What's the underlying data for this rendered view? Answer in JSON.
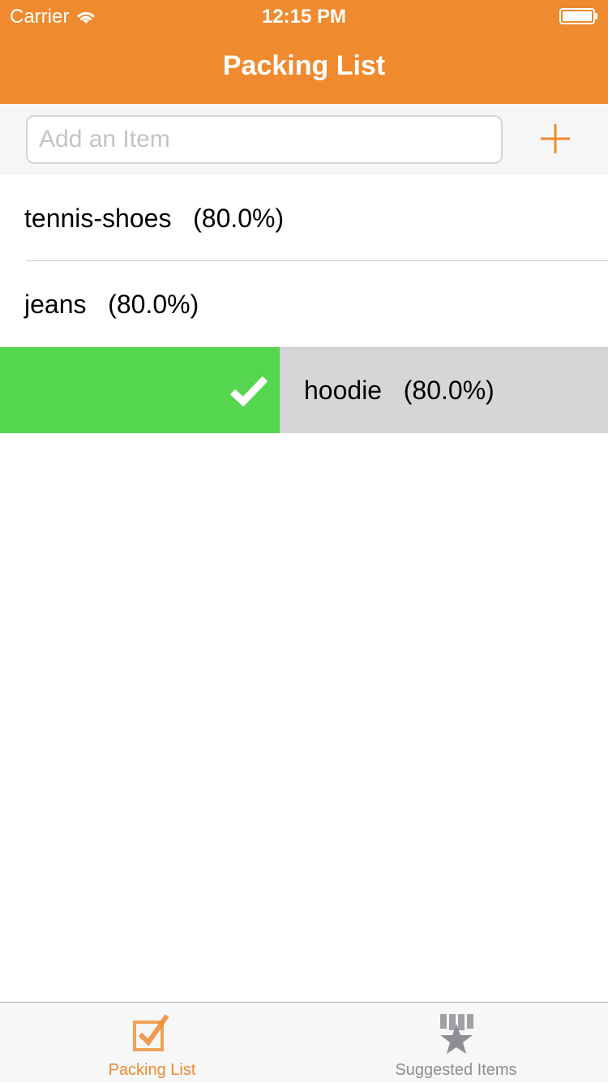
{
  "status_bar": {
    "carrier": "Carrier",
    "time": "12:15 PM"
  },
  "nav": {
    "title": "Packing List"
  },
  "add_item": {
    "placeholder": "Add an Item",
    "value": ""
  },
  "list": {
    "items": [
      {
        "name": "tennis-shoes",
        "percent": "(80.0%)"
      },
      {
        "name": "jeans",
        "percent": "(80.0%)"
      },
      {
        "name": "hoodie",
        "percent": "(80.0%)"
      }
    ]
  },
  "tab_bar": {
    "tabs": [
      {
        "label": "Packing List",
        "icon": "checkbox-icon",
        "selected": true
      },
      {
        "label": "Suggested Items",
        "icon": "medal-star-icon",
        "selected": false
      }
    ]
  },
  "colors": {
    "accent": "#EF8A2F",
    "swipe_action": "#55D64F",
    "swiped_row": "#D6D6D6",
    "tab_inactive": "#8E8E93"
  }
}
